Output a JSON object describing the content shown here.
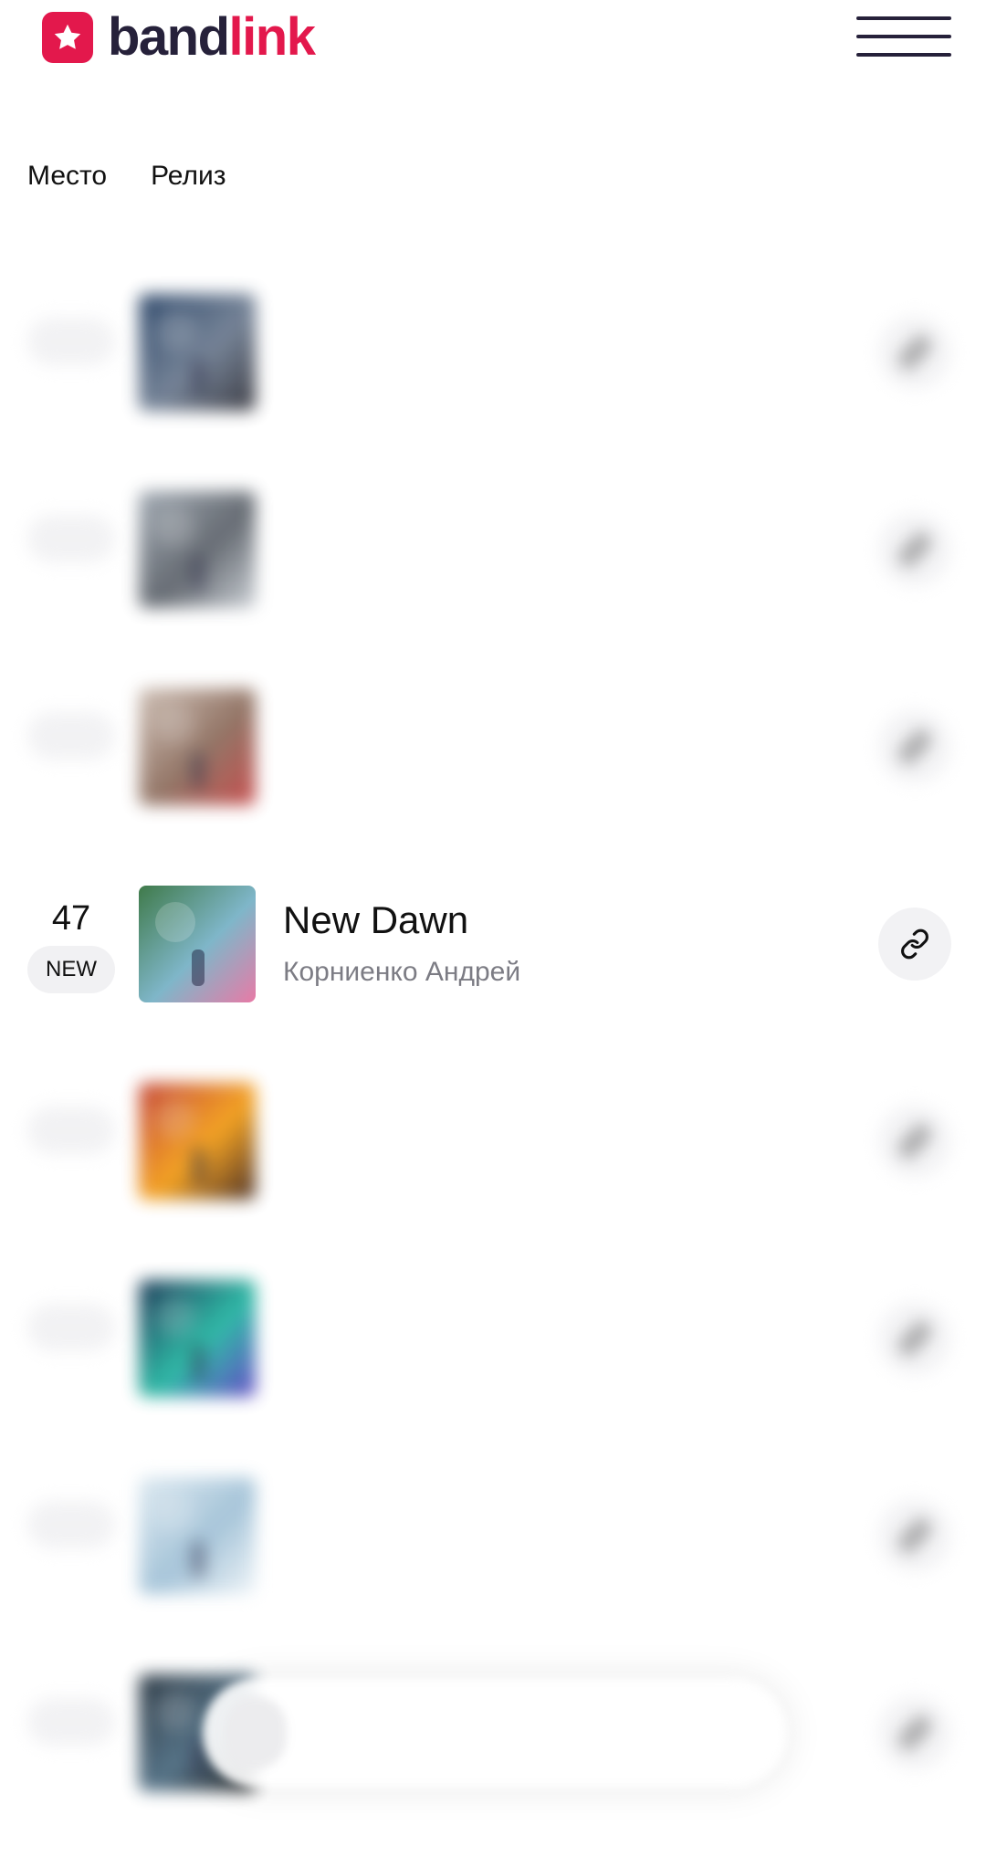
{
  "header": {
    "logo_text_band": "band",
    "logo_text_link": "link",
    "brand_color": "#e3184c",
    "logo_icon": "star-icon",
    "menu_icon": "hamburger-menu-icon"
  },
  "columns": {
    "place": "Место",
    "release": "Релиз"
  },
  "rows": [
    {
      "rank": "",
      "badge": "",
      "title": "",
      "artist": "",
      "blurred": true,
      "cover_colors": [
        "#1e3a5f",
        "#6b7a8f",
        "#2b2b33"
      ]
    },
    {
      "rank": "",
      "badge": "",
      "title": "",
      "artist": "",
      "blurred": true,
      "cover_colors": [
        "#9aa3ad",
        "#5a6068",
        "#c7ccd2"
      ]
    },
    {
      "rank": "",
      "badge": "",
      "title": "",
      "artist": "",
      "blurred": true,
      "cover_colors": [
        "#c9b9ae",
        "#8a6a5a",
        "#c44040"
      ]
    },
    {
      "rank": "47",
      "badge": "NEW",
      "title": "New Dawn",
      "artist": "Корниенко Андрей",
      "blurred": false,
      "cover_colors": [
        "#3f7a4a",
        "#7fb6c9",
        "#e87aa6"
      ]
    },
    {
      "rank": "",
      "badge": "",
      "title": "",
      "artist": "",
      "blurred": true,
      "cover_colors": [
        "#c0392b",
        "#f39c12",
        "#3b1e14"
      ]
    },
    {
      "rank": "",
      "badge": "",
      "title": "",
      "artist": "",
      "blurred": true,
      "cover_colors": [
        "#0b2a4a",
        "#1fb5a0",
        "#5b3cc4"
      ]
    },
    {
      "rank": "",
      "badge": "",
      "title": "",
      "artist": "",
      "blurred": true,
      "cover_colors": [
        "#dbe8f0",
        "#9fc0d6",
        "#eef4f8"
      ]
    },
    {
      "rank": "",
      "badge": "",
      "title": "",
      "artist": "",
      "blurred": true,
      "cover_colors": [
        "#1c2a36",
        "#4a6a80",
        "#0c0c0c"
      ]
    }
  ],
  "period_tabs": [
    "",
    "",
    ""
  ],
  "link_icon": "link-icon"
}
